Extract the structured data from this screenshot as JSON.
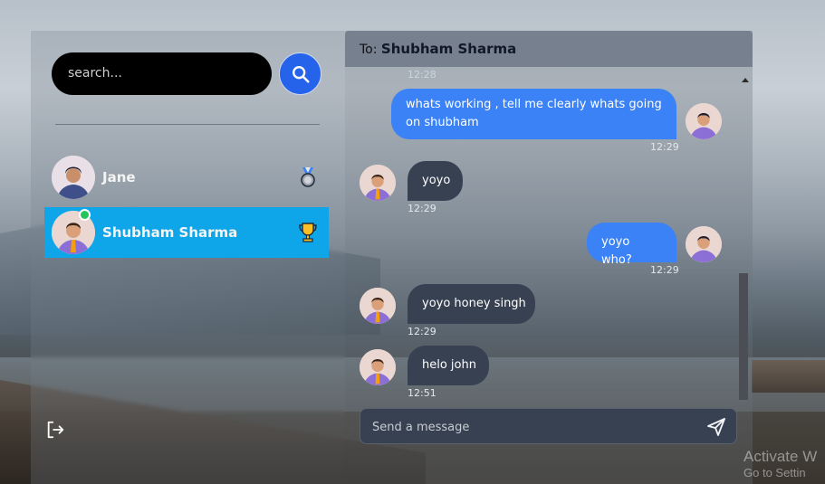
{
  "search": {
    "placeholder": "search..."
  },
  "contacts": [
    {
      "name": "Jane",
      "badge": "medal-icon",
      "online": false,
      "active": false
    },
    {
      "name": "Shubham Sharma",
      "badge": "trophy-icon",
      "online": true,
      "active": true
    }
  ],
  "chat": {
    "to_label": "To:",
    "to_name": "Shubham Sharma",
    "partial_time": "12:28",
    "messages": [
      {
        "direction": "out",
        "text": "whats working , tell me clearly whats going on shubham",
        "time": "12:29"
      },
      {
        "direction": "in",
        "text": "yoyo",
        "time": "12:29"
      },
      {
        "direction": "out",
        "text": "yoyo who?",
        "time": "12:29"
      },
      {
        "direction": "in",
        "text": "yoyo honey singh",
        "time": "12:29"
      },
      {
        "direction": "in",
        "text": "helo john",
        "time": "12:51"
      }
    ],
    "composer_placeholder": "Send a message"
  },
  "watermark": {
    "line1": "Activate W",
    "line2": "Go to Settin"
  },
  "colors": {
    "active_contact": "#0ea5e9",
    "outgoing_bubble": "#3b82f6",
    "incoming_bubble": "#374151",
    "search_button": "#2563eb",
    "online_dot": "#22c55e"
  }
}
